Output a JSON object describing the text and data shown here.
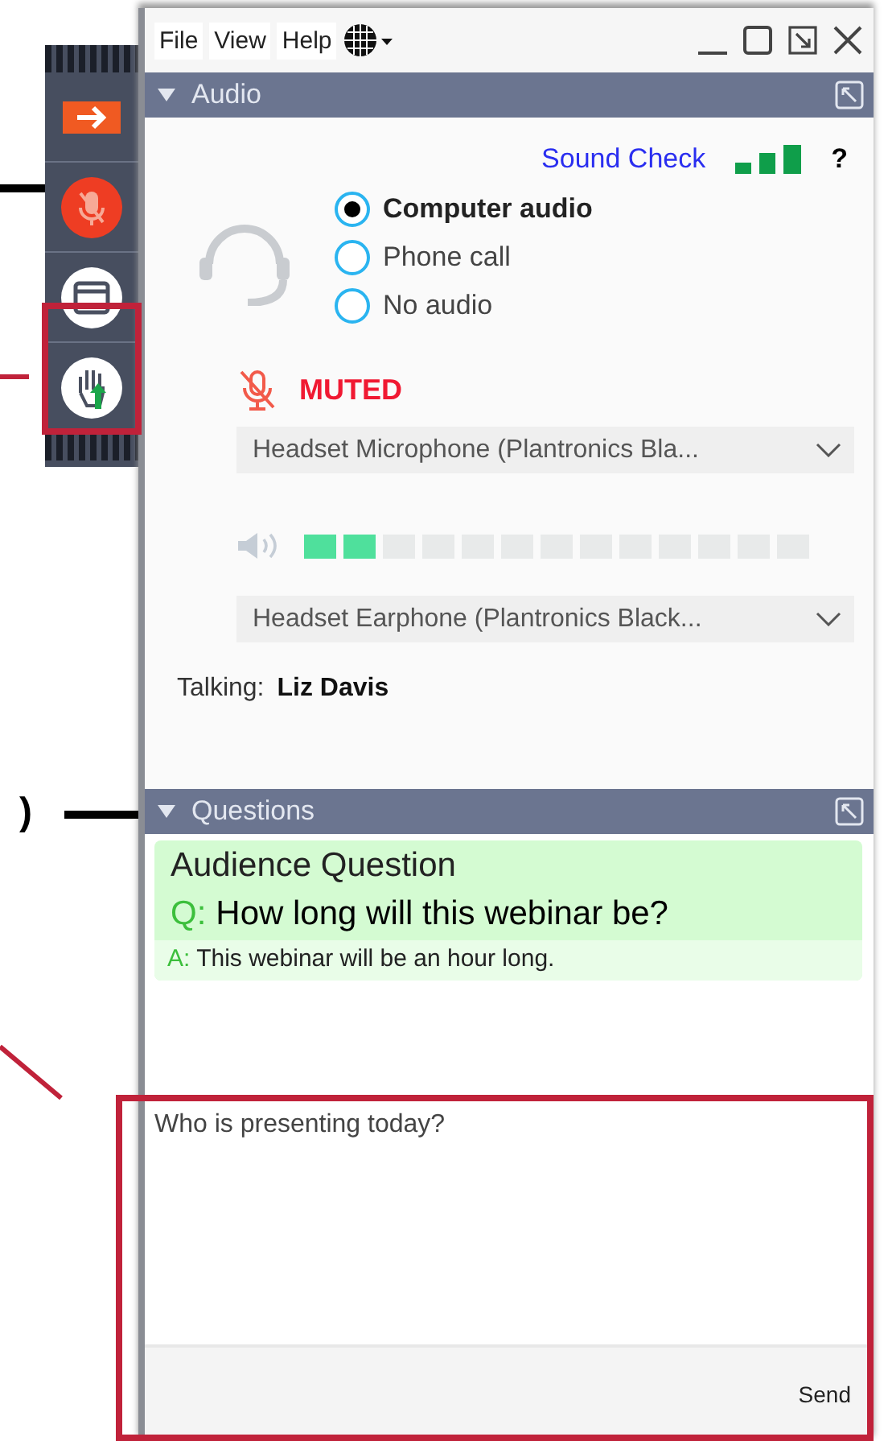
{
  "grab_tab": [
    {
      "kind": "show-hide"
    },
    {
      "kind": "microphone",
      "muted": true
    },
    {
      "kind": "screen"
    },
    {
      "kind": "raise-hand"
    }
  ],
  "menu": [
    {
      "label": "File"
    },
    {
      "label": "View"
    },
    {
      "label": "Help"
    }
  ],
  "audio": {
    "title": "Audio",
    "sound_check": "Sound Check",
    "help": "?",
    "options": [
      {
        "label": "Computer audio",
        "selected": true
      },
      {
        "label": "Phone call",
        "selected": false
      },
      {
        "label": "No audio",
        "selected": false
      }
    ],
    "mute_status": "MUTED",
    "microphone": "Headset Microphone (Plantronics Bla...",
    "speaker_meter": {
      "level": 0.154
    },
    "speaker": "Headset Earphone (Plantronics Black...",
    "talking_label": "Talking:",
    "talking_name": "Liz Davis"
  },
  "questions": {
    "title": "Questions",
    "items": [
      {
        "title": "Audience Question",
        "q_label": "Q:",
        "question": "How long will this webinar be?",
        "a_label": "A:",
        "answer": "This webinar will be an hour long."
      }
    ],
    "input_value": "Who is presenting today?",
    "send": "Send"
  },
  "annotation_label": ")"
}
